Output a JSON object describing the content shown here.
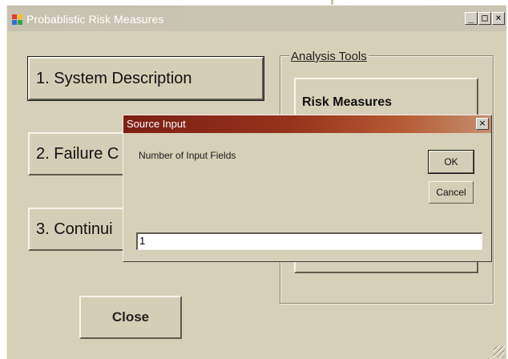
{
  "main_window": {
    "title": "Probablistic Risk Measures",
    "title_buttons": [
      "_",
      "□",
      "×"
    ],
    "buttons": {
      "system_description": "1. System Description",
      "failure": "2. Failure C",
      "continuity": "3. Continui",
      "close": "Close"
    },
    "analysis_tools": {
      "group_label": "Analysis Tools",
      "risk_measures": "Risk Measures"
    }
  },
  "dialog": {
    "title": "Source Input",
    "close_glyph": "×",
    "prompt": "Number of Input Fields",
    "ok_label": "OK",
    "cancel_label": "Cancel",
    "input_value": "1"
  },
  "colors": {
    "window_face": "#d6d0b8",
    "dialog_title_start": "#7c1f14",
    "dialog_title_end": "#c58f70"
  }
}
